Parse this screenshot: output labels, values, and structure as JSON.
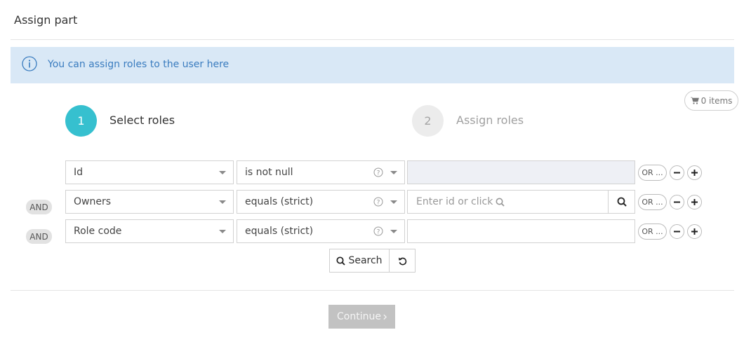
{
  "page": {
    "title": "Assign part"
  },
  "info": {
    "message": "You can assign roles to the user here",
    "icon": "info-circle-icon"
  },
  "cart": {
    "label": "0 items",
    "icon": "shopping-cart-icon"
  },
  "steps": [
    {
      "number": "1",
      "label": "Select roles",
      "active": true
    },
    {
      "number": "2",
      "label": "Assign roles",
      "active": false
    }
  ],
  "filters": [
    {
      "connector": "",
      "field": "Id",
      "operator": "is not null",
      "value": "",
      "value_placeholder": "",
      "value_disabled": true,
      "or_label": "OR ..."
    },
    {
      "connector": "AND",
      "field": "Owners",
      "operator": "equals (strict)",
      "value": "",
      "value_placeholder": "Enter id or click",
      "value_disabled": false,
      "or_label": "OR ..."
    },
    {
      "connector": "AND",
      "field": "Role code",
      "operator": "equals (strict)",
      "value": "",
      "value_placeholder": "",
      "value_disabled": false,
      "or_label": "OR ..."
    }
  ],
  "actions": {
    "search_label": "Search",
    "continue_label": "Continue"
  },
  "colors": {
    "accent": "#36c0cf",
    "info_bg": "#d9e8f6",
    "info_text": "#3a7cbf",
    "disabled_button": "#c2c2c2"
  }
}
